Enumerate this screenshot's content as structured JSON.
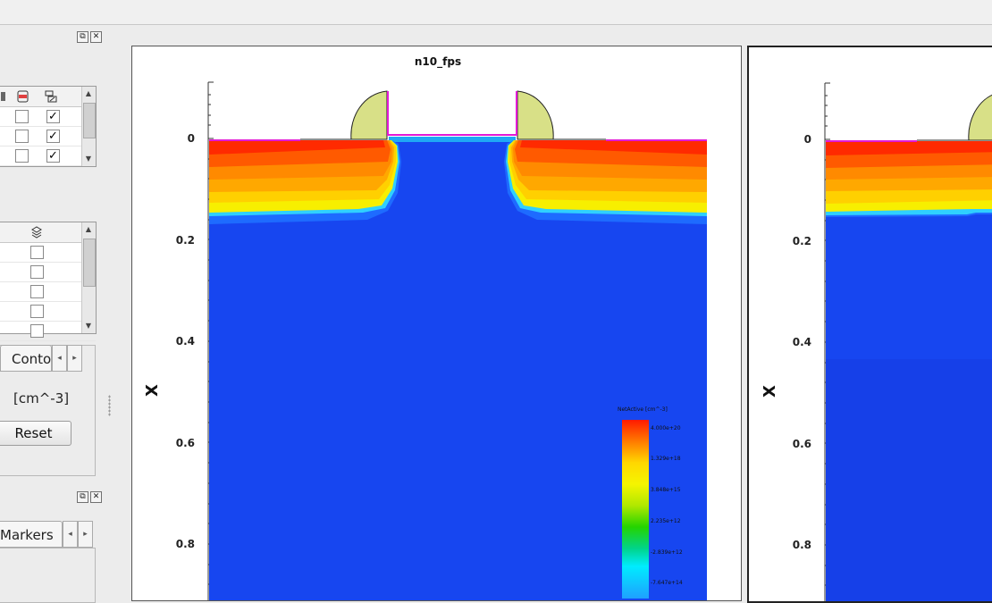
{
  "left_panel": {
    "regions_table": {
      "rows": [
        {
          "c1": false,
          "c2": true
        },
        {
          "c1": false,
          "c2": true
        },
        {
          "c1": false,
          "c2": true
        }
      ]
    },
    "fields_table": {
      "rows": [
        {
          "c1": false
        },
        {
          "c1": false
        },
        {
          "c1": false
        },
        {
          "c1": false
        },
        {
          "c1": false
        }
      ]
    },
    "tabs": {
      "contour_label": "Conto",
      "markers_label": "Markers"
    },
    "unit_label": "[cm^-3]",
    "reset_label": "Reset"
  },
  "plot1": {
    "title": "n10_fps",
    "ylabel": "X",
    "y_ticks": [
      "0",
      "0.2",
      "0.4",
      "0.6",
      "0.8"
    ],
    "legend": {
      "title": "NetActive [cm^-3]",
      "labels": [
        "4.000e+20",
        "1.329e+18",
        "3.848e+15",
        "2.235e+12",
        "-2.839e+12",
        "-7.647e+14"
      ]
    }
  },
  "plot2": {
    "ylabel": "X",
    "y_ticks": [
      "0",
      "0.2",
      "0.4",
      "0.6",
      "0.8"
    ]
  },
  "colors": {
    "substrate_blue": "#1746f0",
    "spacer": "#d8e087",
    "gate_outline": "#e21ad6"
  }
}
